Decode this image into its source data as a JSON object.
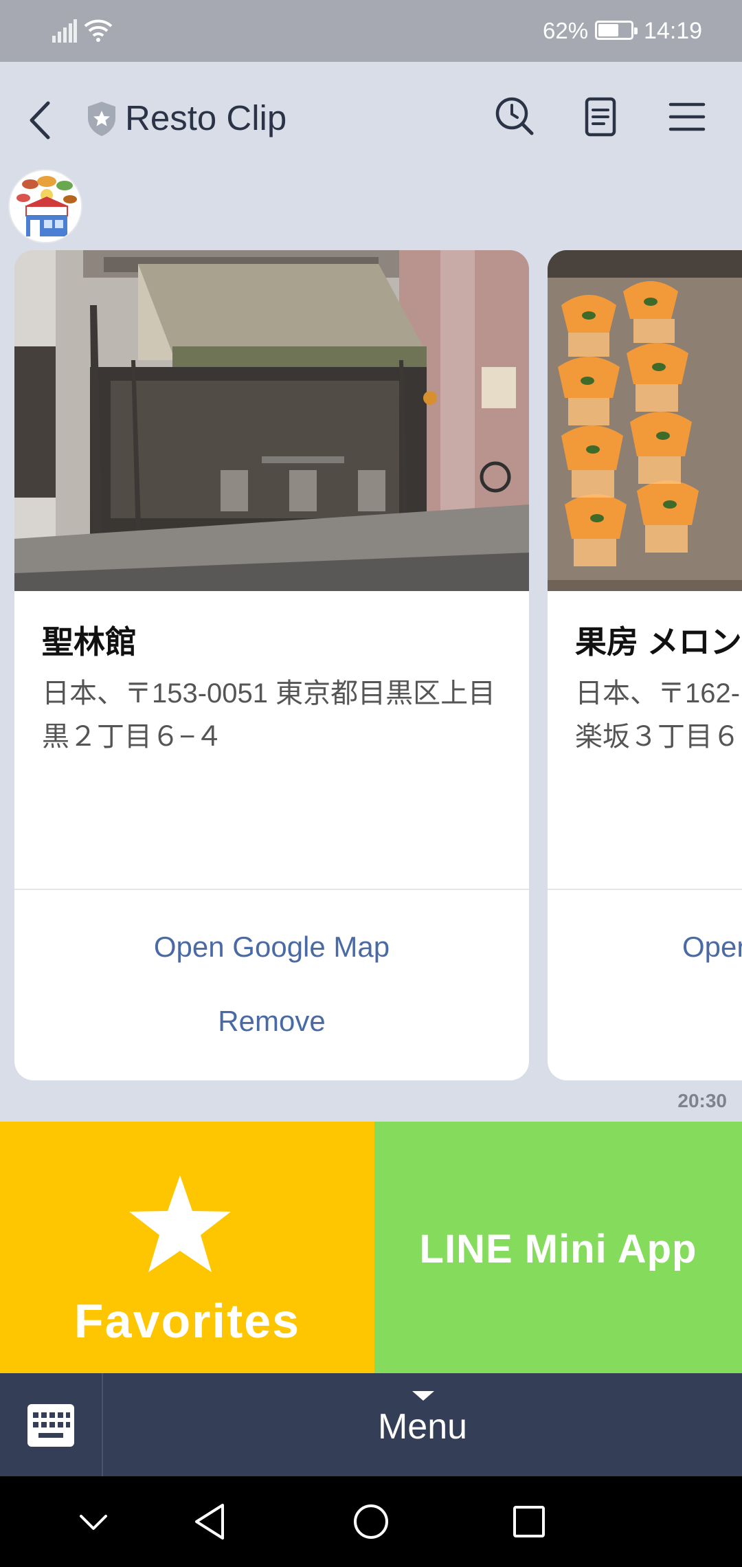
{
  "status_bar": {
    "battery_percent": "62%",
    "battery_level": 0.62,
    "time": "14:19"
  },
  "header": {
    "title": "Resto Clip"
  },
  "icons": {
    "back": "chevron-left-icon",
    "verified": "shield-star-icon",
    "search": "search-clock-icon",
    "notes": "note-icon",
    "menu": "hamburger-icon",
    "keyboard": "keyboard-icon",
    "star": "star-icon"
  },
  "cards": [
    {
      "name": "聖林館",
      "address": "日本、〒153-0051 東京都目黒区上目黒２丁目６−４",
      "actions": [
        "Open Google Map",
        "Remove"
      ]
    },
    {
      "name": "果房 メロン",
      "address": "日本、〒162-",
      "address_line2": "楽坂３丁目６",
      "actions": [
        "Oper"
      ]
    }
  ],
  "message": {
    "time": "20:30"
  },
  "rich_menu": {
    "favorites_label": "Favorites",
    "mini_app_label": "LINE Mini App"
  },
  "menu_bar": {
    "label": "Menu"
  },
  "colors": {
    "favorites": "#fec600",
    "mini_app": "#84db5c",
    "menu_bar": "#343e56",
    "link": "#4a6aa5"
  }
}
